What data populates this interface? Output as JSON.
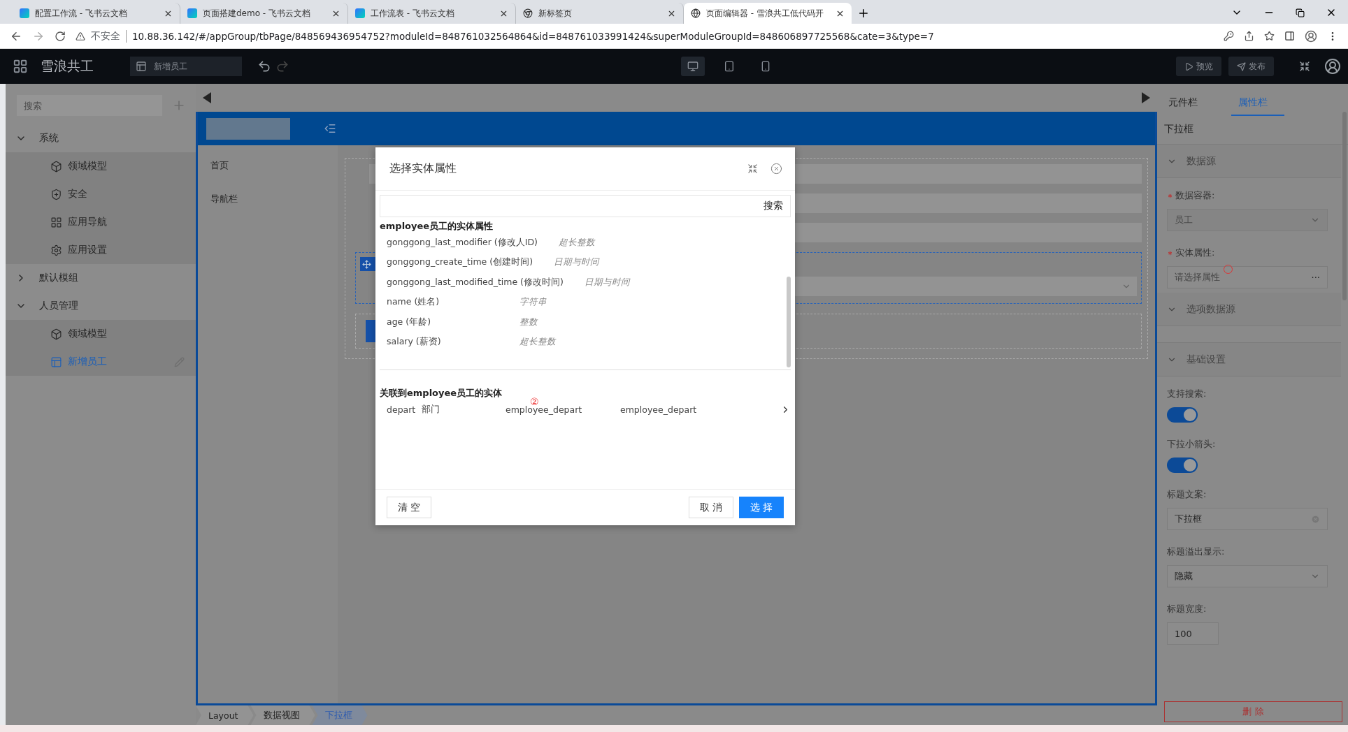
{
  "browser": {
    "tabs": [
      {
        "title": "配置工作流 - 飞书云文档",
        "kind": "document",
        "selected": false
      },
      {
        "title": "页面搭建demo - 飞书云文档",
        "kind": "document",
        "selected": false
      },
      {
        "title": "工作流表 - 飞书云文档",
        "kind": "document",
        "selected": false
      },
      {
        "title": "新标签页",
        "kind": "newtab",
        "selected": false
      },
      {
        "title": "页面编辑器 - 雪浪共工低代码开",
        "kind": "site",
        "selected": true
      }
    ],
    "security": "不安全",
    "url": "10.88.36.142/#/appGroup/tbPage/848569436954752?moduleId=848761032564864&id=848761033991424&superModuleGroupId=848606897725568&cate=3&type=7"
  },
  "header": {
    "app_name": "雪浪共工",
    "page": "新增员工",
    "devices": [
      {
        "kind": "desktop",
        "selected": true
      },
      {
        "kind": "tablet",
        "selected": false
      },
      {
        "kind": "phone",
        "selected": false
      }
    ],
    "buttons": [
      {
        "kind": "preview",
        "label": "预览"
      },
      {
        "kind": "publish",
        "label": "发布"
      }
    ]
  },
  "sidebar": {
    "search": {
      "placeholder": "搜索"
    },
    "tree": [
      {
        "label": "系统",
        "expanded": true,
        "children": [
          {
            "label": "领域模型",
            "kind": "model",
            "selected": false
          },
          {
            "label": "安全",
            "kind": "security",
            "selected": false
          },
          {
            "label": "应用导航",
            "kind": "navigation",
            "selected": false
          },
          {
            "label": "应用设置",
            "kind": "settings",
            "selected": false
          }
        ]
      },
      {
        "label": "默认模组",
        "expanded": false
      },
      {
        "label": "人员管理",
        "expanded": true,
        "children": [
          {
            "label": "领域模型",
            "kind": "model",
            "selected": false
          },
          {
            "label": "新增员工",
            "kind": "page",
            "selected": true
          }
        ]
      }
    ]
  },
  "canvas": {
    "nav": [
      "首页",
      "导航栏"
    ]
  },
  "breadcrumb": [
    {
      "label": "Layout",
      "selected": false
    },
    {
      "label": "数据视图",
      "selected": false
    },
    {
      "label": "下拉框",
      "selected": true
    }
  ],
  "modal": {
    "title": "选择实体属性",
    "search_button": "搜索",
    "attributes": {
      "title": "employee员工的实体属性",
      "rows": [
        {
          "name": "gonggong_last_modifier (修改人ID)",
          "type": "超长整数"
        },
        {
          "name": "gonggong_create_time (创建时间)",
          "type": "日期与时间"
        },
        {
          "name": "gonggong_last_modified_time (修改时间)",
          "type": "日期与时间"
        },
        {
          "name": "name (姓名)",
          "type": "字符串"
        },
        {
          "name": "age (年龄)",
          "type": "整数"
        },
        {
          "name": "salary (薪资)",
          "type": "超长整数"
        }
      ]
    },
    "relations": {
      "title": "关联到employee员工的实体",
      "rows": [
        {
          "field": "depart",
          "label": "部门",
          "entity": "employee_depart",
          "table": "employee_depart"
        }
      ]
    },
    "annotation": "②",
    "buttons": [
      {
        "kind": "clear",
        "label": "清 空"
      },
      {
        "kind": "cancel",
        "label": "取 消"
      },
      {
        "kind": "confirm",
        "label": "选 择"
      }
    ]
  },
  "panel": {
    "tabs": [
      {
        "label": "元件栏",
        "selected": false
      },
      {
        "label": "属性栏",
        "selected": true
      }
    ],
    "title": "下拉框",
    "items": [
      {
        "kind": "section",
        "label": "数据源",
        "expanded": true
      },
      {
        "kind": "label",
        "label": "数据容器:",
        "required": true
      },
      {
        "kind": "select",
        "value": "员工",
        "disabled": true
      },
      {
        "kind": "label",
        "label": "实体属性:",
        "required": true
      },
      {
        "kind": "picker",
        "placeholder": "请选择属性",
        "button": "···"
      },
      {
        "kind": "section",
        "label": "选项数据源",
        "expanded": true
      },
      {
        "kind": "section",
        "label": "基础设置",
        "expanded": true
      },
      {
        "kind": "label",
        "label": "支持搜索:",
        "required": false
      },
      {
        "kind": "switch",
        "on": true
      },
      {
        "kind": "label",
        "label": "下拉小箭头:",
        "required": false
      },
      {
        "kind": "switch",
        "on": true
      },
      {
        "kind": "label",
        "label": "标题文案:",
        "required": false
      },
      {
        "kind": "clearable",
        "value": "下拉框"
      },
      {
        "kind": "label",
        "label": "标题溢出显示:",
        "required": false
      },
      {
        "kind": "select",
        "value": "隐藏",
        "disabled": false
      },
      {
        "kind": "label",
        "label": "标题宽度:",
        "required": false
      },
      {
        "kind": "short",
        "value": "100"
      }
    ],
    "delete_button": "删 除"
  }
}
